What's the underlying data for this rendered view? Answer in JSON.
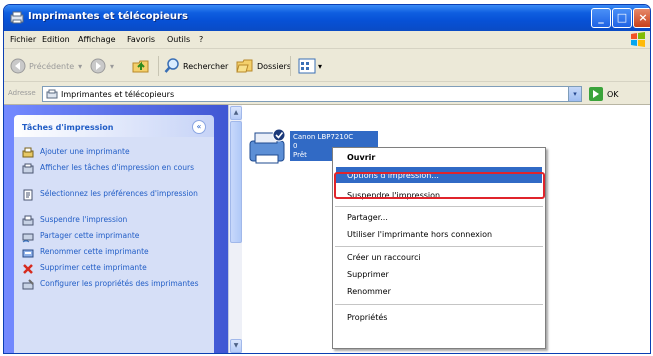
{
  "window": {
    "title": "Imprimantes et télécopieurs"
  },
  "menubar": {
    "items": [
      "Fichier",
      "Edition",
      "Affichage",
      "Favoris",
      "Outils",
      "?"
    ]
  },
  "toolbar": {
    "back": "Précédente",
    "search": "Rechercher",
    "folders": "Dossiers"
  },
  "address": {
    "label": "Adresse",
    "value": "Imprimantes et télécopieurs",
    "go": "OK"
  },
  "taskpane": {
    "title": "Tâches d'impression",
    "tasks": [
      "Ajouter une imprimante",
      "Afficher les tâches d'impression en cours",
      "Sélectionnez les préférences d'impression",
      "Suspendre l'impression",
      "Partager cette imprimante",
      "Renommer cette imprimante",
      "Supprimer cette imprimante",
      "Configurer les propriétés des imprimantes"
    ]
  },
  "printer": {
    "name_line1": "Canon LBP7210C",
    "name_line2": "0",
    "status": "Prêt"
  },
  "context_menu": {
    "open": "Ouvrir",
    "print_options": "Options d'impression...",
    "pause": "Suspendre l'impression",
    "share": "Partager...",
    "use_offline": "Utiliser l'imprimante hors connexion",
    "create_shortcut": "Créer un raccourci",
    "delete": "Supprimer",
    "rename": "Renommer",
    "properties": "Propriétés"
  },
  "colors": {
    "titlebar": "#0751d6",
    "highlight": "#316ac5",
    "callout": "#e0242b",
    "task_link": "#215dc6"
  }
}
